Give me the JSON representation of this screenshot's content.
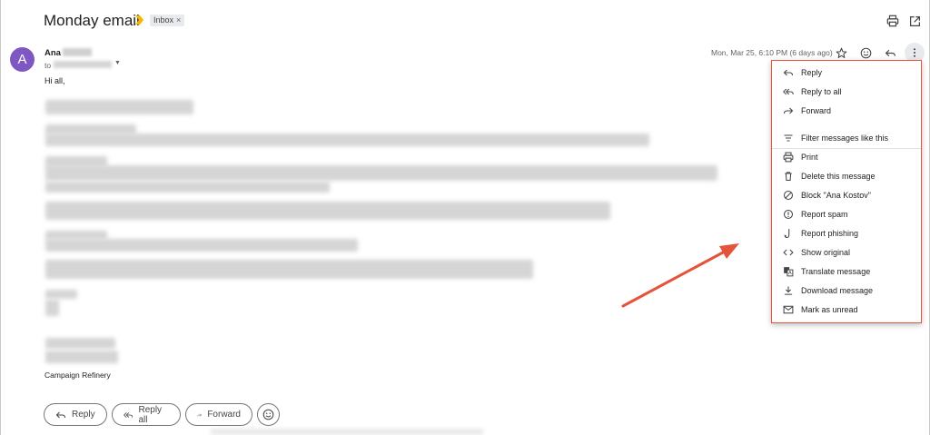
{
  "email": {
    "subject": "Monday email",
    "label_chip": "Inbox",
    "chip_close": "×",
    "sender_name": "Ana",
    "to_prefix": "to",
    "timestamp": "Mon, Mar 25, 6:10 PM (6 days ago)",
    "avatar_letter": "A",
    "greeting": "Hi all,",
    "signature": "Campaign Refinery"
  },
  "actions": {
    "reply": "Reply",
    "reply_all": "Reply all",
    "forward": "Forward"
  },
  "menu": {
    "items": [
      {
        "label": "Reply",
        "icon": "reply-icon"
      },
      {
        "label": "Reply to all",
        "icon": "reply-all-icon"
      },
      {
        "label": "Forward",
        "icon": "forward-icon"
      },
      {
        "label": "Filter messages like this",
        "icon": "filter-icon"
      },
      {
        "label": "Print",
        "icon": "print-icon"
      },
      {
        "label": "Delete this message",
        "icon": "trash-icon"
      },
      {
        "label": "Block \"Ana Kostov\"",
        "icon": "block-icon"
      },
      {
        "label": "Report spam",
        "icon": "spam-icon"
      },
      {
        "label": "Report phishing",
        "icon": "phishing-icon"
      },
      {
        "label": "Show original",
        "icon": "code-icon"
      },
      {
        "label": "Translate message",
        "icon": "translate-icon"
      },
      {
        "label": "Download message",
        "icon": "download-icon"
      },
      {
        "label": "Mark as unread",
        "icon": "mail-icon"
      }
    ]
  },
  "colors": {
    "avatar": "#7e57c2",
    "importance": "#f2b600",
    "menu_outline": "#e4533a",
    "arrow": "#e4533a"
  }
}
